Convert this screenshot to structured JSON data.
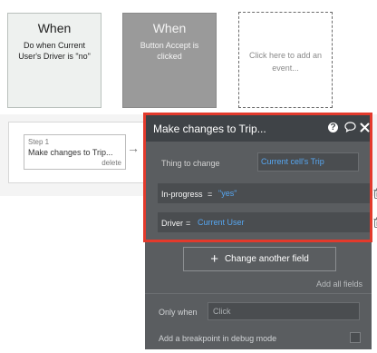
{
  "events": [
    {
      "title": "When",
      "description": "Do when Current User's Driver is \"no\""
    },
    {
      "title": "When",
      "description": "Button Accept is clicked"
    }
  ],
  "add_event": {
    "label": "Click here to add an event..."
  },
  "step": {
    "number": "Step 1",
    "name": "Make changes to Trip...",
    "delete_label": "delete",
    "arrow": "→"
  },
  "panel": {
    "title": "Make changes to Trip...",
    "help": "?",
    "thing_label": "Thing to change",
    "thing_value": "Current cell's Trip",
    "fields": [
      {
        "key": "In-progress",
        "op": "=",
        "value": "\"yes\""
      },
      {
        "key": "Driver",
        "op": "=",
        "value": "Current User"
      }
    ],
    "change_button": "Change another field",
    "add_all": "Add all fields",
    "only_when_label": "Only when",
    "only_when_placeholder": "Click",
    "breakpoint_label": "Add a breakpoint in debug mode"
  },
  "icons": {
    "help": "help-icon",
    "comment": "comment-icon",
    "close": "close-icon",
    "trash": "trash-icon",
    "plus": "plus-icon",
    "arrow": "arrow-right-icon"
  },
  "colors": {
    "panel_bg": "#5a5d60",
    "panel_header": "#3f4347",
    "highlight_outline": "#e33a2c",
    "dynamic_value": "#56a6f0"
  }
}
